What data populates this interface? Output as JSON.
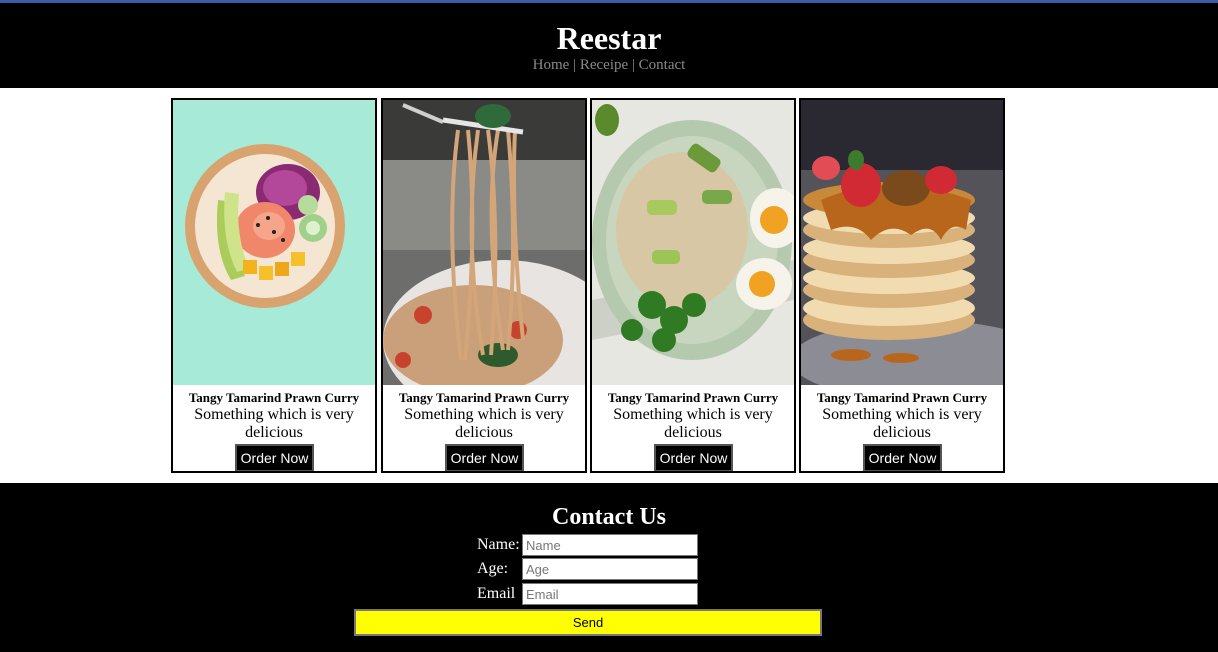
{
  "site": {
    "brand": "Reestar"
  },
  "nav": [
    {
      "label": "Home"
    },
    {
      "label": "Receipe"
    },
    {
      "label": "Contact"
    }
  ],
  "nav_separator": "|",
  "cards": [
    {
      "title": "Tangy Tamarind Prawn Curry",
      "description": "Something which is very delicious",
      "button": "Order Now",
      "image": "poke-bowl"
    },
    {
      "title": "Tangy Tamarind Prawn Curry",
      "description": "Something which is very delicious",
      "button": "Order Now",
      "image": "spaghetti-fork"
    },
    {
      "title": "Tangy Tamarind Prawn Curry",
      "description": "Something which is very delicious",
      "button": "Order Now",
      "image": "rice-egg-salad"
    },
    {
      "title": "Tangy Tamarind Prawn Curry",
      "description": "Something which is very delicious",
      "button": "Order Now",
      "image": "pancake-stack"
    }
  ],
  "contact": {
    "heading": "Contact Us",
    "name_label": "Name:",
    "name_placeholder": "Name",
    "age_label": "Age:",
    "age_placeholder": "Age",
    "email_label": "Email",
    "email_placeholder": "Email",
    "send_label": "Send"
  },
  "colors": {
    "header_bg": "#000000",
    "accent_line": "#3a5ea8",
    "send_button": "#ffff00",
    "nav_text": "#8a8a8a"
  }
}
